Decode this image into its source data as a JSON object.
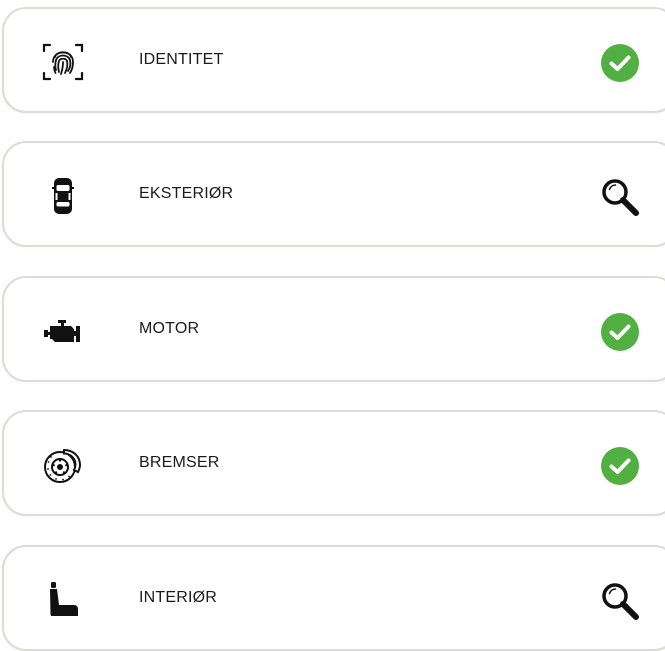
{
  "inspection_items": [
    {
      "label": "IDENTITET",
      "icon": "fingerprint-icon",
      "status": "completed",
      "status_icon": "check-circle-icon"
    },
    {
      "label": "EKSTERIØR",
      "icon": "car-top-view-icon",
      "status": "inspect",
      "status_icon": "magnifier-icon"
    },
    {
      "label": "MOTOR",
      "icon": "engine-icon",
      "status": "completed",
      "status_icon": "check-circle-icon"
    },
    {
      "label": "BREMSER",
      "icon": "brake-disc-icon",
      "status": "completed",
      "status_icon": "check-circle-icon"
    },
    {
      "label": "INTERIØR",
      "icon": "car-seat-icon",
      "status": "inspect",
      "status_icon": "magnifier-icon"
    }
  ],
  "colors": {
    "check_green": "#52b043",
    "card_border": "#dcdcd6",
    "text": "#1b1b1b",
    "icon": "#111111"
  }
}
